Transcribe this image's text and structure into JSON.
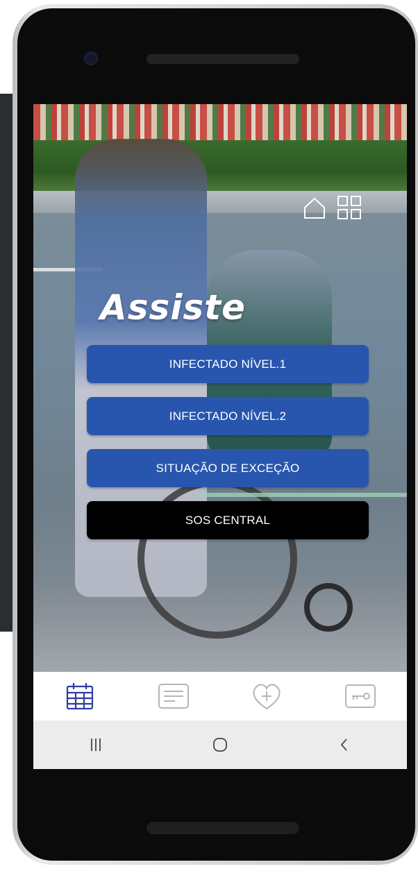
{
  "app": {
    "logo_text": "Assiste"
  },
  "actions": {
    "infected_level_1": "INFECTADO NÍVEL.1",
    "infected_level_2": "INFECTADO NÍVEL.2",
    "exception_situation": "SITUAÇÃO DE EXCEÇÃO",
    "sos_central": "SOS CENTRAL"
  },
  "top_icons": [
    "home-icon",
    "grid-icon"
  ],
  "bottom_nav": {
    "items": [
      {
        "icon": "calendar-icon",
        "active": true
      },
      {
        "icon": "document-icon",
        "active": false
      },
      {
        "icon": "heart-plus-icon",
        "active": false
      },
      {
        "icon": "key-icon",
        "active": false
      }
    ]
  },
  "system_nav": [
    "recent-apps-icon",
    "home-button-icon",
    "back-icon"
  ],
  "colors": {
    "primary_button": "#2856ae",
    "sos_button": "#000000",
    "active_nav": "#2e3d9e",
    "inactive_nav": "#b5b5b5"
  }
}
